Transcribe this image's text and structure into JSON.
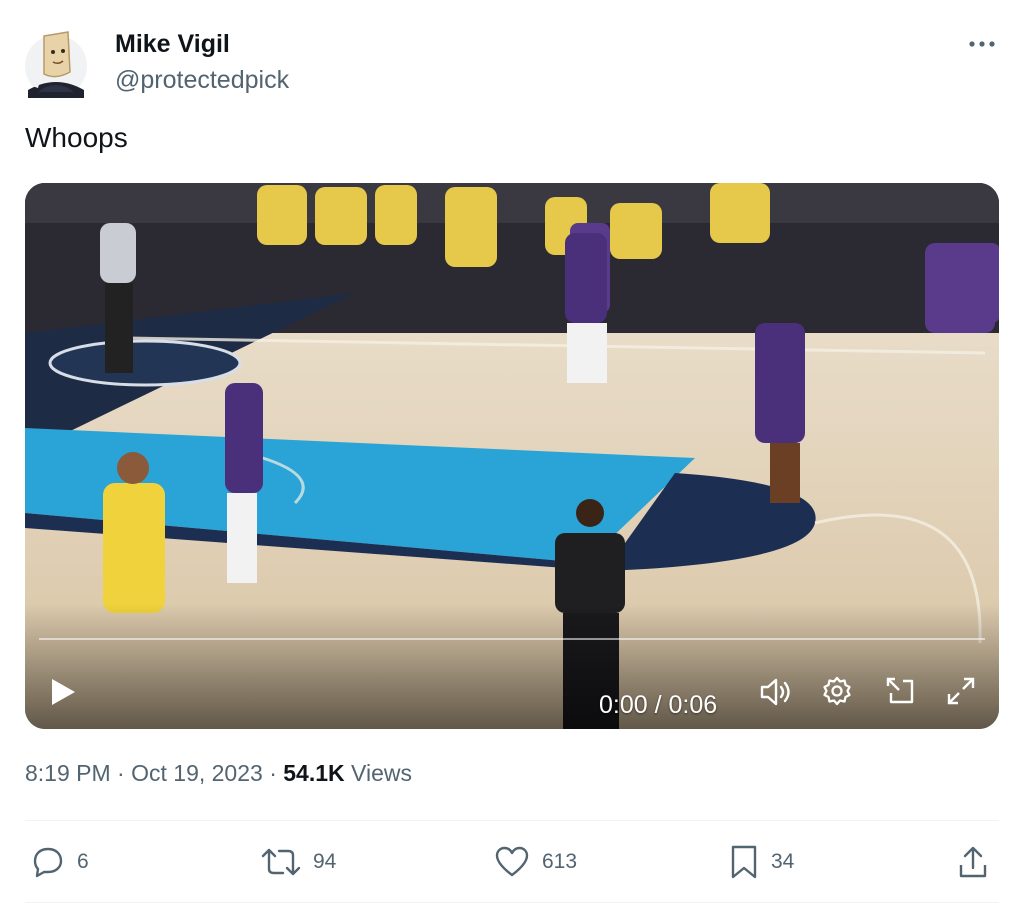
{
  "author": {
    "name": "Mike Vigil",
    "handle": "@protectedpick"
  },
  "tweet": {
    "text": "Whoops"
  },
  "video": {
    "time_display": "0:00 / 0:06",
    "progress": 0,
    "controls": [
      "play-icon",
      "volume-icon",
      "settings-icon",
      "pip-icon",
      "fullscreen-icon"
    ]
  },
  "meta": {
    "time": "8:19 PM",
    "sep1": "·",
    "date": "Oct 19, 2023",
    "sep2": "·",
    "views_count": "54.1K",
    "views_label": "Views"
  },
  "actions": {
    "replies": "6",
    "reposts": "94",
    "likes": "613",
    "bookmarks": "34"
  },
  "colors": {
    "text_primary": "#0f1419",
    "text_secondary": "#536471",
    "divider": "#eff3f4"
  }
}
